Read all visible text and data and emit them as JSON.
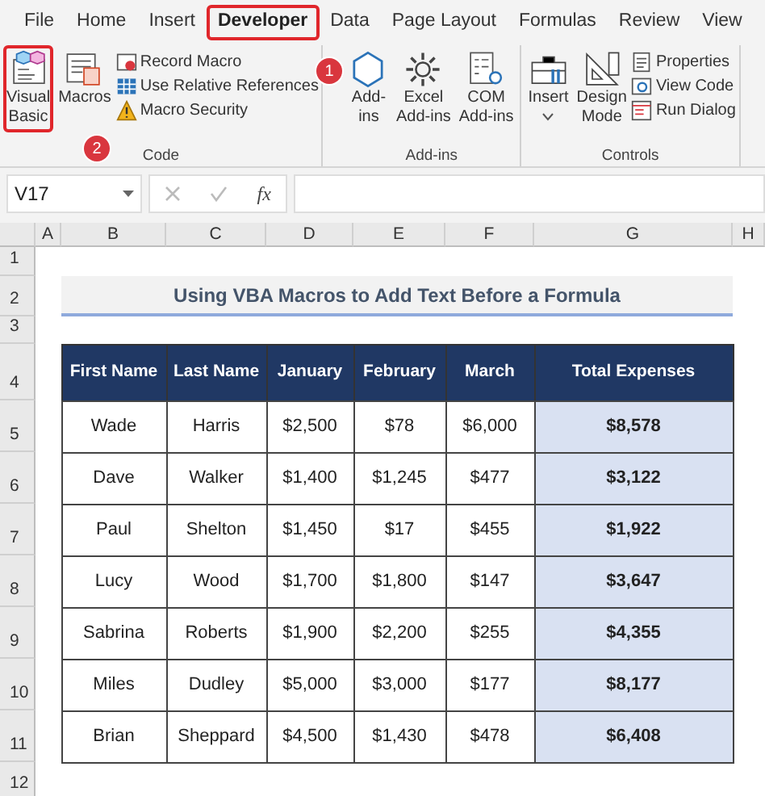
{
  "ribbon_tabs": [
    {
      "label": "File",
      "selected": false
    },
    {
      "label": "Home",
      "selected": false
    },
    {
      "label": "Insert",
      "selected": false
    },
    {
      "label": "Developer",
      "selected": true
    },
    {
      "label": "Data",
      "selected": false
    },
    {
      "label": "Page Layout",
      "selected": false
    },
    {
      "label": "Formulas",
      "selected": false
    },
    {
      "label": "Review",
      "selected": false
    },
    {
      "label": "View",
      "selected": false
    }
  ],
  "ribbon_groups": [
    {
      "label": "Code",
      "buttons": [
        {
          "kind": "large",
          "label": "Visual\nBasic",
          "highlighted": true
        },
        {
          "kind": "large",
          "label": "Macros",
          "highlighted": false
        },
        {
          "kind": "stack",
          "items": [
            {
              "label": "Record Macro"
            },
            {
              "label": "Use Relative References"
            },
            {
              "label": "Macro Security"
            }
          ]
        }
      ]
    },
    {
      "label": "Add-ins",
      "buttons": [
        {
          "kind": "large",
          "label": "Add-\nins",
          "highlighted": false
        },
        {
          "kind": "large",
          "label": "Excel\nAdd-ins",
          "highlighted": false
        },
        {
          "kind": "large",
          "label": "COM\nAdd-ins",
          "highlighted": false
        }
      ]
    },
    {
      "label": "Controls",
      "buttons": [
        {
          "kind": "dropdown",
          "label": "Insert",
          "highlighted": false
        },
        {
          "kind": "large",
          "label": "Design\nMode",
          "highlighted": false
        },
        {
          "kind": "stack",
          "items": [
            {
              "label": "Properties"
            },
            {
              "label": "View Code"
            },
            {
              "label": "Run Dialog"
            }
          ]
        }
      ]
    }
  ],
  "callouts": [
    {
      "label": "1"
    },
    {
      "label": "2"
    }
  ],
  "formula_bar": {
    "name_box": "V17",
    "function_label": "fx"
  },
  "columns": [
    "A",
    "B",
    "C",
    "D",
    "E",
    "F",
    "G",
    "H"
  ],
  "rows": [
    "1",
    "2",
    "3",
    "4",
    "5",
    "6",
    "7",
    "8",
    "9",
    "10",
    "11",
    "12"
  ],
  "title": "Using VBA Macros to Add Text Before a Formula",
  "table": {
    "columns": [
      "First Name",
      "Last Name",
      "January",
      "February",
      "March",
      "Total Expenses"
    ],
    "rows": [
      [
        "Wade",
        "Harris",
        "$2,500",
        "$78",
        "$6,000",
        "$8,578"
      ],
      [
        "Dave",
        "Walker",
        "$1,400",
        "$1,245",
        "$477",
        "$3,122"
      ],
      [
        "Paul",
        "Shelton",
        "$1,450",
        "$17",
        "$455",
        "$1,922"
      ],
      [
        "Lucy",
        "Wood",
        "$1,700",
        "$1,800",
        "$147",
        "$3,647"
      ],
      [
        "Sabrina",
        "Roberts",
        "$1,900",
        "$2,200",
        "$255",
        "$4,355"
      ],
      [
        "Miles",
        "Dudley",
        "$5,000",
        "$3,000",
        "$177",
        "$8,177"
      ],
      [
        "Brian",
        "Sheppard",
        "$4,500",
        "$1,430",
        "$478",
        "$6,408"
      ]
    ]
  }
}
